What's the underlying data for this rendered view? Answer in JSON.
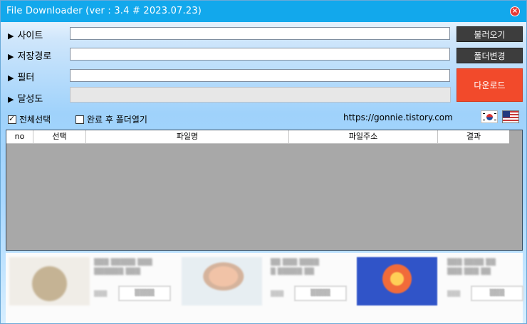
{
  "window": {
    "title": "File Downloader (ver : 3.4 # 2023.07.23)"
  },
  "form": {
    "site_label": "사이트",
    "save_path_label": "저장경로",
    "filter_label": "필터",
    "progress_label": "달성도",
    "site_value": "",
    "save_path_value": "",
    "filter_value": "",
    "progress": 0
  },
  "buttons": {
    "load": "불러오기",
    "change_folder": "폴더변경",
    "download": "다운로드"
  },
  "options": {
    "select_all": "전체선택",
    "select_all_checked": true,
    "open_folder": "완료 후 폴더열기",
    "open_folder_checked": false
  },
  "blog_url": "https://gonnie.tistory.com",
  "table": {
    "columns": [
      "no",
      "선택",
      "파일명",
      "파일주소",
      "결과"
    ],
    "rows": []
  },
  "colors": {
    "titlebar": "#12a8ec",
    "button_dark": "#3d3d3d",
    "download_button": "#f24a2b",
    "table_background": "#a8a8a8"
  }
}
